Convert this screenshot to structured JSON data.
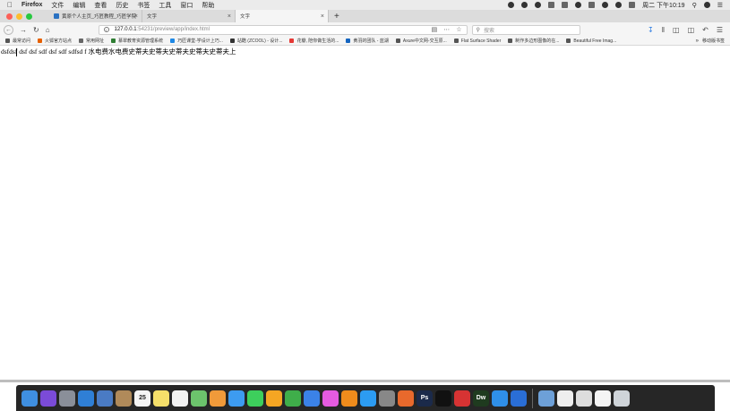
{
  "menubar": {
    "apple_icon": "apple-icon",
    "items": [
      "Firefox",
      "文件",
      "编辑",
      "查看",
      "历史",
      "书签",
      "工具",
      "窗口",
      "帮助"
    ],
    "clock": "周二 下午10:19"
  },
  "tabs": [
    {
      "title": "黄原个人主页_巧匠教程_巧匠学院",
      "active": false
    },
    {
      "title": "文字",
      "active": false
    },
    {
      "title": "文字",
      "active": true
    }
  ],
  "new_tab_label": "+",
  "nav": {
    "url_host": "127.0.0.1",
    "url_path": ":54231/preview/app/index.html",
    "search_placeholder": "搜索"
  },
  "bookmarks": [
    {
      "label": "最常访问",
      "color": "#555555"
    },
    {
      "label": "火狐官方站点",
      "color": "#e66000"
    },
    {
      "label": "常用网址",
      "color": "#666666"
    },
    {
      "label": "慕翠教育资源管理系统",
      "color": "#2e7d32"
    },
    {
      "label": "巧匠课堂-学设计上巧...",
      "color": "#1e88e5"
    },
    {
      "label": "站酷 (ZCOOL) - 设计...",
      "color": "#333333"
    },
    {
      "label": "花瓣, 陪你做生活的...",
      "color": "#e53935"
    },
    {
      "label": "黄羽的团队 - 蓝湖",
      "color": "#1565c0"
    },
    {
      "label": "Axure中文网-交互原...",
      "color": "#555555"
    },
    {
      "label": "Flat Surface Shader",
      "color": "#555555"
    },
    {
      "label": "制作多边形图像的在...",
      "color": "#555555"
    },
    {
      "label": "Beautiful Free Imag...",
      "color": "#555555"
    }
  ],
  "bookmarks_more": "»",
  "mobile_bookmarks": "移动版书签",
  "page": {
    "text": "dsfdsf dsf dsf sdf dsf sdf sdfsd f 水电费水电费史蒂夫史蒂夫史蒂夫史蒂夫史蒂夫上"
  },
  "dock": {
    "apps": [
      {
        "name": "finder",
        "color": "#3f8fe0"
      },
      {
        "name": "siri",
        "color": "#7b4bd8"
      },
      {
        "name": "launchpad",
        "color": "#8a8f99"
      },
      {
        "name": "safari",
        "color": "#2f7fd6"
      },
      {
        "name": "preview",
        "color": "#4a7bc4"
      },
      {
        "name": "contacts",
        "color": "#b08a5a"
      },
      {
        "name": "calendar",
        "color": "#f4f4f4",
        "label": "25"
      },
      {
        "name": "notes",
        "color": "#f5df6a"
      },
      {
        "name": "reminders",
        "color": "#f2f2f2"
      },
      {
        "name": "maps",
        "color": "#6cc36c"
      },
      {
        "name": "photos",
        "color": "#f09a3a"
      },
      {
        "name": "messages-blue",
        "color": "#3d9bf0"
      },
      {
        "name": "messages",
        "color": "#3dcf5c"
      },
      {
        "name": "pages",
        "color": "#f5a623"
      },
      {
        "name": "numbers",
        "color": "#3fae4a"
      },
      {
        "name": "keynote",
        "color": "#3b82e8"
      },
      {
        "name": "itunes",
        "color": "#e55be0"
      },
      {
        "name": "ibooks",
        "color": "#f08c1c"
      },
      {
        "name": "app-store",
        "color": "#2c9cf2"
      },
      {
        "name": "system-preferences",
        "color": "#888888"
      },
      {
        "name": "firefox",
        "color": "#e8692c"
      },
      {
        "name": "photoshop",
        "color": "#1b2a4a",
        "label": "Ps"
      },
      {
        "name": "qq",
        "color": "#111111"
      },
      {
        "name": "xmind",
        "color": "#d73333"
      },
      {
        "name": "dreamweaver",
        "color": "#1f3b1f",
        "label": "Dw"
      },
      {
        "name": "baidu-netdisk",
        "color": "#2f8fe8"
      },
      {
        "name": "browser-blue",
        "color": "#2a6ed6"
      }
    ],
    "right_apps": [
      {
        "name": "downloads",
        "color": "#6da0d8"
      },
      {
        "name": "dock-window-1",
        "color": "#eeeeee"
      },
      {
        "name": "keyboard",
        "color": "#dddddd"
      },
      {
        "name": "dock-window-2",
        "color": "#f4f4f4"
      },
      {
        "name": "trash",
        "color": "#cfd4d9"
      }
    ]
  }
}
